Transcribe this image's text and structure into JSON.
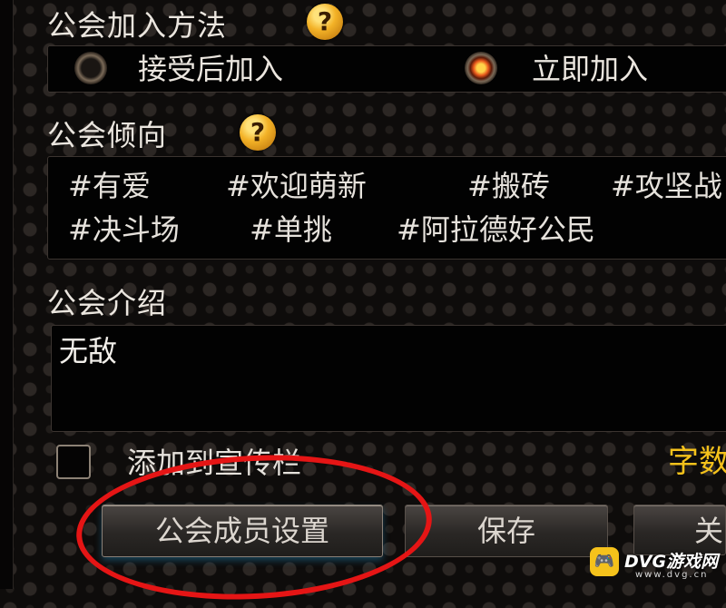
{
  "join_method": {
    "label": "公会加入方法",
    "help_icon_glyph": "?",
    "options": [
      {
        "label": "接受后加入",
        "selected": false
      },
      {
        "label": "立即加入",
        "selected": true
      }
    ]
  },
  "tendency": {
    "label": "公会倾向",
    "help_icon_glyph": "?",
    "tags": [
      "#有爱",
      "#欢迎萌新",
      "#搬砖",
      "#攻坚战",
      "#决斗场",
      "#单挑",
      "#阿拉德好公民"
    ]
  },
  "intro": {
    "label": "公会介绍",
    "text": "无敌"
  },
  "promo": {
    "label": "添加到宣传栏",
    "checked": false,
    "word_count_label": "字数"
  },
  "buttons": {
    "member_settings": "公会成员设置",
    "save": "保存",
    "close": "关"
  },
  "watermark": {
    "badge_glyph": "🎮",
    "brand": "DVG游戏网",
    "domain": "www.dvg.cn"
  },
  "colors": {
    "accent_gold": "#f5c21b",
    "annotation_red": "#e51515",
    "panel_bg": "#020202"
  }
}
